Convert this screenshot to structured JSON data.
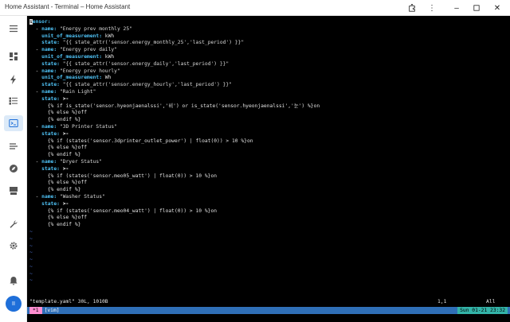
{
  "window": {
    "title": "Home Assistant - Terminal – Home Assistant"
  },
  "sidebar": {
    "items": [
      {
        "name": "menu-icon"
      },
      {
        "name": "overview-icon"
      },
      {
        "name": "energy-icon"
      },
      {
        "name": "logbook-icon"
      },
      {
        "name": "terminal-icon",
        "active": true
      },
      {
        "name": "history-icon"
      },
      {
        "name": "map-icon"
      },
      {
        "name": "hacs-icon"
      },
      {
        "name": "developer-tools-icon"
      },
      {
        "name": "settings-icon"
      },
      {
        "name": "notifications-icon"
      }
    ],
    "avatar_initials": "II",
    "active_color": "#dceaf8"
  },
  "editor": {
    "lines": [
      "sensor:",
      "  - name: \"Energy prev monthly 25\"",
      "    unit_of_measurement: kWh",
      "    state: \"{{ state_attr('sensor.energy_monthly_25','last_period') }}\"",
      "  - name: \"Energy prev daily\"",
      "    unit_of_measurement: kWh",
      "    state: \"{{ state_attr('sensor.energy_daily','last_period') }}\"",
      "  - name: \"Energy prev hourly\"",
      "    unit_of_measurement: Wh",
      "    state: \"{{ state_attr('sensor.energy_hourly','last_period') }}\"",
      "  - name: \"Rain Light\"",
      "    state: >-",
      "      {% if is_state('sensor.hyeonjaenalssi','비') or is_state('sensor.hyeonjaenalssi','눈') %}on",
      "      {% else %}off",
      "      {% endif %}",
      "  - name: \"3D Printer Status\"",
      "    state: >-",
      "      {% if (states('sensor.3dprinter_outlet_power') | float(0)) > 10 %}on",
      "      {% else %}off",
      "      {% endif %}",
      "  - name: \"Dryer Status\"",
      "    state: >-",
      "      {% if (states('sensor.meo05_watt') | float(0)) > 10 %}on",
      "      {% else %}off",
      "      {% endif %}",
      "  - name: \"Washer Status\"",
      "    state: >-",
      "      {% if (states('sensor.meo04_watt') | float(0)) > 10 %}on",
      "      {% else %}off",
      "      {% endif %}"
    ],
    "empty_line_marker": "~",
    "empty_line_count": 8,
    "file_info": "\"template.yaml\" 30L, 1010B",
    "cursor_position": "1,1",
    "scroll_position": "All"
  },
  "statusbar": {
    "window_label": "*1",
    "session_label": "[vim]",
    "clock": "Sun 01-21 23:32",
    "color": "#2f6fb7"
  }
}
